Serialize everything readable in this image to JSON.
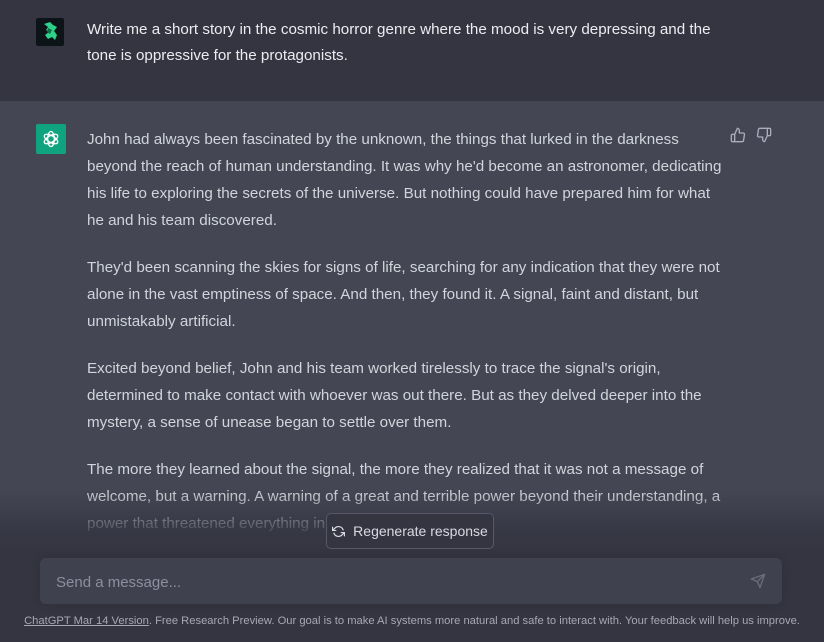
{
  "user_message": {
    "avatar": "user-avatar-icon",
    "text": "Write me a short story in the cosmic horror genre where the mood is very depressing and the tone is oppressive for the protagonists."
  },
  "assistant_message": {
    "avatar": "chatgpt-logo-icon",
    "paragraphs": [
      "John had always been fascinated by the unknown, the things that lurked in the darkness beyond the reach of human understanding. It was why he'd become an astronomer, dedicating his life to exploring the secrets of the universe. But nothing could have prepared him for what he and his team discovered.",
      "They'd been scanning the skies for signs of life, searching for any indication that they were not alone in the vast emptiness of space. And then, they found it. A signal, faint and distant, but unmistakably artificial.",
      "Excited beyond belief, John and his team worked tirelessly to trace the signal's origin, determined to make contact with whoever was out there. But as they delved deeper into the mystery, a sense of unease began to settle over them.",
      "The more they learned about the signal, the more they realized that it was not a message of welcome, but a warning. A warning of a great and terrible power beyond their understanding, a power that threatened everything in the universe."
    ],
    "feedback_icons": [
      "thumbs-up-icon",
      "thumbs-down-icon"
    ]
  },
  "regenerate": {
    "label": "Regenerate response",
    "icon": "refresh-icon"
  },
  "composer": {
    "placeholder": "Send a message...",
    "send_icon": "send-icon"
  },
  "footer": {
    "link_text": "ChatGPT Mar 14 Version",
    "text": ". Free Research Preview. Our goal is to make AI systems more natural and safe to interact with. Your feedback will help us improve."
  },
  "colors": {
    "background": "#343541",
    "assistant_background": "#444654",
    "accent": "#10a37f"
  }
}
